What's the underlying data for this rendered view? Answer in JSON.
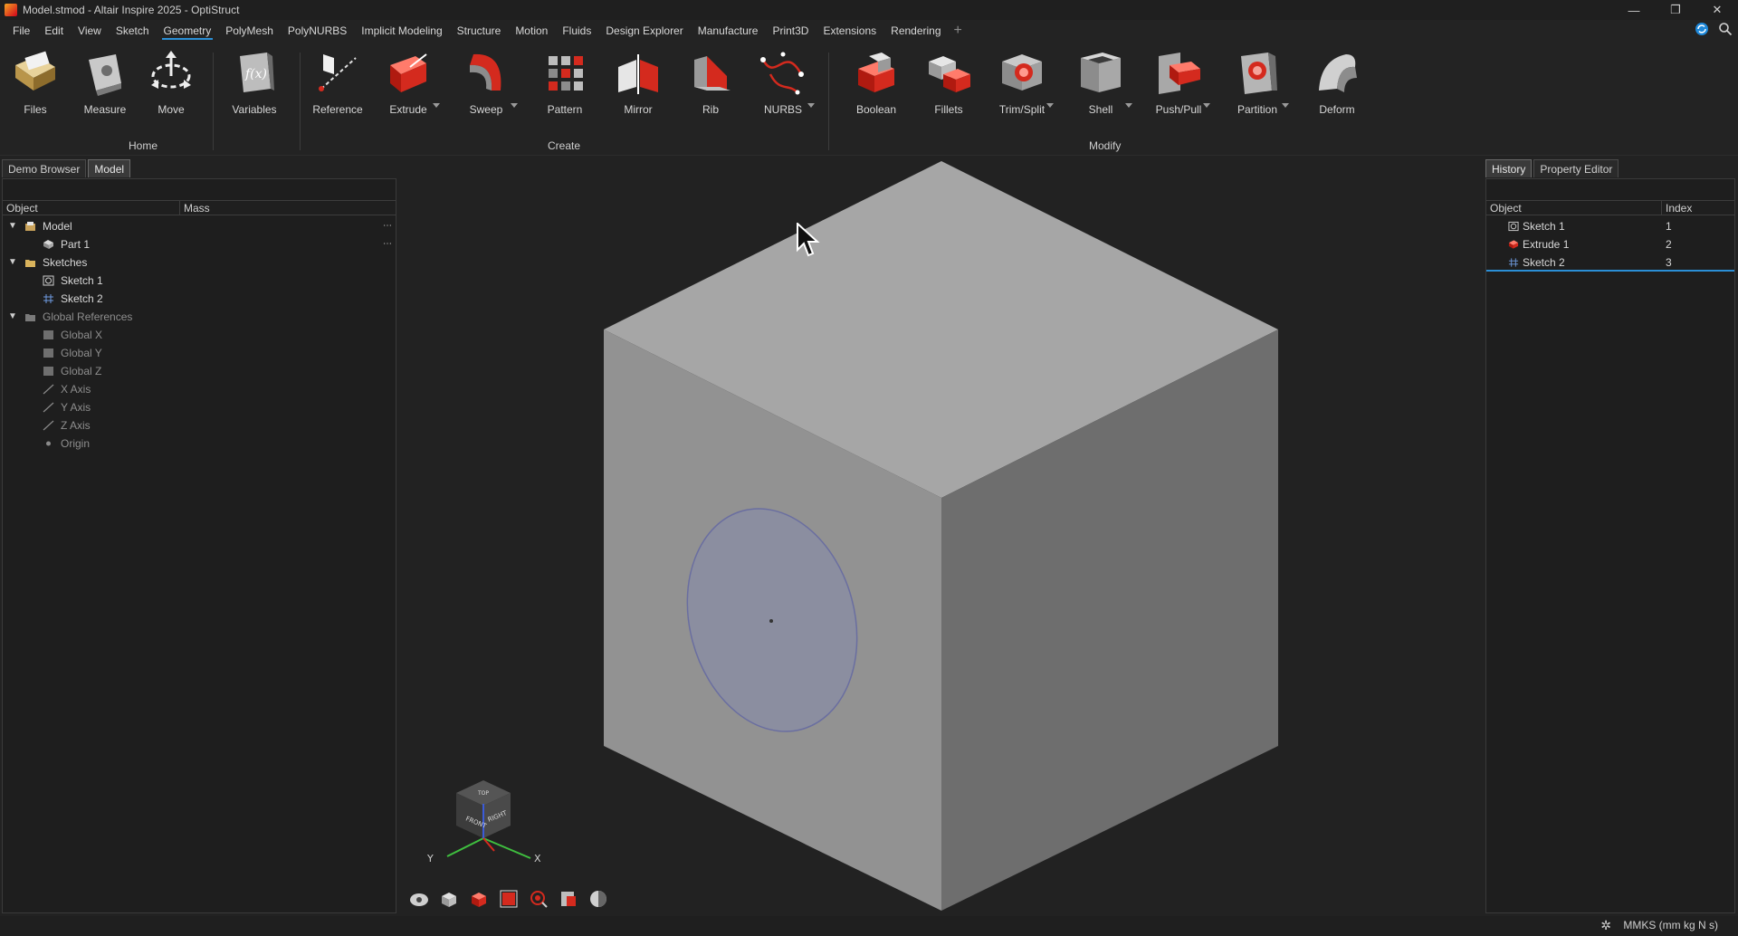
{
  "window": {
    "title": "Model.stmod - Altair Inspire 2025 - OptiStruct",
    "controls": [
      "—",
      "❐",
      "✕"
    ]
  },
  "menus": [
    "File",
    "Edit",
    "View",
    "Sketch",
    "Geometry",
    "PolyMesh",
    "PolyNURBS",
    "Implicit Modeling",
    "Structure",
    "Motion",
    "Fluids",
    "Design Explorer",
    "Manufacture",
    "Print3D",
    "Extensions",
    "Rendering"
  ],
  "active_menu": "Geometry",
  "menu_plus": "+",
  "ribbon": {
    "home": {
      "label": "Home",
      "tools": [
        "Files",
        "Measure",
        "Move"
      ]
    },
    "variables": "Variables",
    "create": {
      "label": "Create",
      "tools": [
        "Reference",
        "Extrude",
        "Sweep",
        "Pattern",
        "Mirror",
        "Rib",
        "NURBS"
      ]
    },
    "modify": {
      "label": "Modify",
      "tools": [
        "Boolean",
        "Fillets",
        "Trim/Split",
        "Shell",
        "Push/Pull",
        "Partition",
        "Deform"
      ]
    },
    "variables_glyph": "f(x)"
  },
  "left_tabs": [
    "Demo Browser",
    "Model"
  ],
  "left_active_tab": "Model",
  "model_browser": {
    "columns": [
      "Object",
      "Mass"
    ],
    "tree": [
      {
        "label": "Model",
        "icon": "model-icon"
      },
      {
        "label": "Part 1",
        "icon": "part-icon"
      },
      {
        "label": "Sketches",
        "icon": "folder-icon"
      },
      {
        "label": "Sketch 1",
        "icon": "sketch-icon"
      },
      {
        "label": "Sketch 2",
        "icon": "sketch-icon"
      },
      {
        "label": "Global References",
        "icon": "folder-icon"
      },
      {
        "label": "Global X",
        "icon": "plane-icon"
      },
      {
        "label": "Global Y",
        "icon": "plane-icon"
      },
      {
        "label": "Global Z",
        "icon": "plane-icon"
      },
      {
        "label": "X Axis",
        "icon": "axis-icon"
      },
      {
        "label": "Y Axis",
        "icon": "axis-icon"
      },
      {
        "label": "Z Axis",
        "icon": "axis-icon"
      },
      {
        "label": "Origin",
        "icon": "origin-icon"
      }
    ],
    "expander": "▼",
    "row_menu": "⋯"
  },
  "right_tabs": [
    "History",
    "Property Editor"
  ],
  "right_active_tab": "History",
  "history": {
    "columns": [
      "Object",
      "Index"
    ],
    "rows": [
      {
        "object": "Sketch 1",
        "index": "1"
      },
      {
        "object": "Extrude 1",
        "index": "2"
      },
      {
        "object": "Sketch 2",
        "index": "3"
      }
    ]
  },
  "panel_tools": [
    "▣",
    "⌕",
    "✕"
  ],
  "viewcube": {
    "front": "FRONT",
    "right": "RIGHT",
    "top": "TOP",
    "axis_x": "X",
    "axis_y": "Y"
  },
  "status": {
    "units": "MMKS (mm kg N s)",
    "gear": "✲"
  },
  "colors": {
    "accent": "#2b8fd6",
    "cube_top": "#a6a6a6",
    "cube_left": "#929292",
    "cube_right": "#6e6e6e",
    "sketch_circle": "#8b8ea0",
    "icon_red": "#d42a1e"
  }
}
